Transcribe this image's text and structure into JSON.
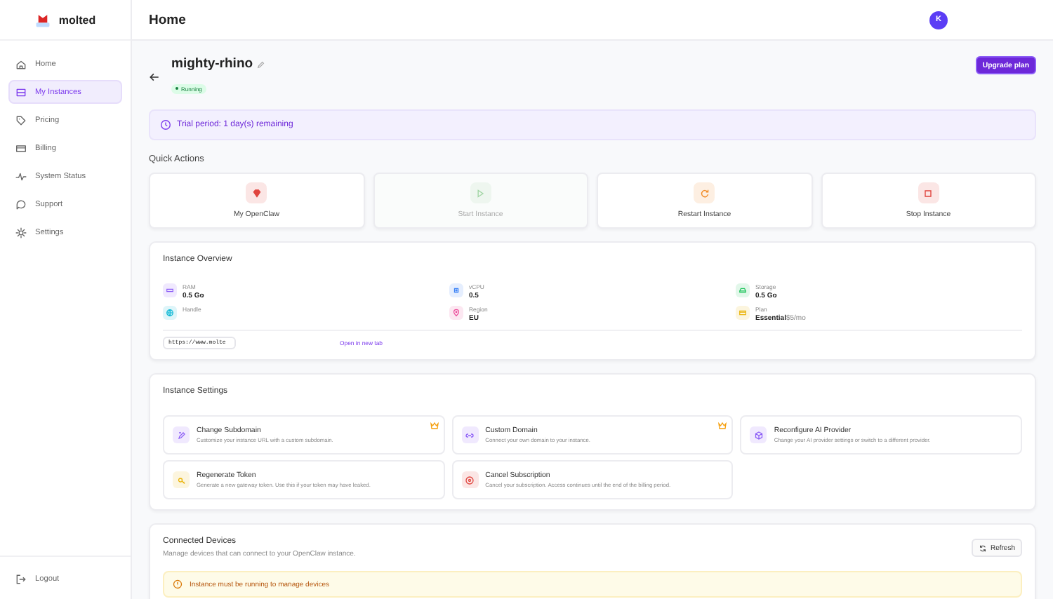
{
  "brand": {
    "name": "molted"
  },
  "sidebar": {
    "items": [
      {
        "label": "Home",
        "selected": false
      },
      {
        "label": "My Instances",
        "selected": true
      },
      {
        "label": "Pricing",
        "selected": false
      },
      {
        "label": "Billing",
        "selected": false
      },
      {
        "label": "System Status",
        "selected": false
      },
      {
        "label": "Support",
        "selected": false
      },
      {
        "label": "Settings",
        "selected": false
      }
    ],
    "logout": "Logout"
  },
  "header": {
    "title": "Home",
    "avatar": "K"
  },
  "instance": {
    "name": "mighty-rhino",
    "status": "Running",
    "running": true,
    "upgrade": "Upgrade plan"
  },
  "trial_banner": "Trial period: 1 day(s) remaining",
  "quick_actions": {
    "title": "Quick Actions",
    "items": [
      {
        "label": "My OpenClaw",
        "disabled": false
      },
      {
        "label": "Start Instance",
        "disabled": true
      },
      {
        "label": "Restart Instance",
        "disabled": false
      },
      {
        "label": "Stop Instance",
        "disabled": false
      }
    ]
  },
  "overview": {
    "title": "Instance Overview",
    "stats": [
      {
        "label": "RAM",
        "value": "0.5 Go"
      },
      {
        "label": "vCPU",
        "value": "0.5"
      },
      {
        "label": "Storage",
        "value": "0.5 Go"
      },
      {
        "label": "Handle"
      },
      {
        "label": "Region",
        "value": "EU"
      },
      {
        "label": "Plan",
        "value": "Essential",
        "extra": "$5/mo"
      }
    ],
    "url": "https://www.molte",
    "open_link": "Open in new tab"
  },
  "settings": {
    "title": "Instance Settings",
    "items": [
      {
        "title": "Change Subdomain",
        "desc": "Customize your instance URL with a custom subdomain.",
        "premium": true
      },
      {
        "title": "Custom Domain",
        "desc": "Connect your own domain to your instance.",
        "premium": true
      },
      {
        "title": "Reconfigure AI Provider",
        "desc": "Change your AI provider settings or switch to a different provider.",
        "premium": false
      },
      {
        "title": "Regenerate Token",
        "desc": "Generate a new gateway token. Use this if your token may have leaked.",
        "premium": false
      },
      {
        "title": "Cancel Subscription",
        "desc": "Cancel your subscription. Access continues until the end of the billing period.",
        "premium": false
      }
    ]
  },
  "devices": {
    "title": "Connected Devices",
    "subtitle": "Manage devices that can connect to your OpenClaw instance.",
    "refresh": "Refresh",
    "warning": "Instance must be running to manage devices"
  }
}
